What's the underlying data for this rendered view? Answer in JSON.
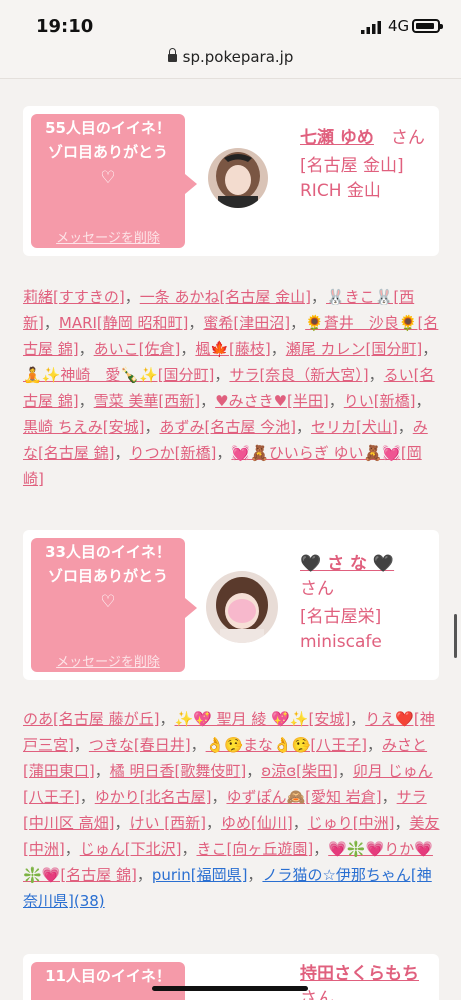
{
  "status": {
    "time": "19:10",
    "network": "4G"
  },
  "browser": {
    "url": "sp.pokepara.jp"
  },
  "cards": [
    {
      "message": "55人目のイイネ！ ゾロ目ありがとう",
      "heart": "♡",
      "delete_label": "メッセージを削除",
      "name": "七瀬 ゆめ",
      "honorific": "さん",
      "shop": "[名古屋 金山] RICH 金山"
    },
    {
      "message": "33人目のイイネ！ ゾロ目ありがとう",
      "heart": "♡",
      "delete_label": "メッセージを削除",
      "name": "🖤 さ な 🖤",
      "honorific": "さん",
      "shop": "[名古屋栄] miniscafe"
    },
    {
      "message": "11人目のイイネ！",
      "name": "持田さくらもち",
      "honorific": "さん"
    }
  ],
  "likers_1": [
    "莉緒[すすきの]",
    "一条 あかね[名古屋 金山]",
    "🐰きこ🐰[西新]",
    "MARI[静岡 昭和町]",
    "蜜希[津田沼]",
    "🌻蒼井　沙良🌻[名古屋 錦]",
    "あいこ[佐倉]",
    "楓🍁[藤枝]",
    "瀬尾 カレン[国分町]",
    "🧘✨神崎　愛🍾✨[国分町]",
    "サラ[奈良（新大宮）]",
    "るい[名古屋 錦]",
    "雪菜 美華[西新]",
    "♥みさき♥[半田]",
    "りい[新橋]",
    "黒崎 ちえみ[安城]",
    "あずみ[名古屋 今池]",
    "セリカ[犬山]",
    "みな[名古屋 錦]",
    "りつか[新橋]",
    "💓🧸ひいらぎ ゆい🧸💓[岡崎]"
  ],
  "likers_2": [
    "のあ[名古屋 藤が丘]",
    "✨💖 聖月 綾 💖✨[安城]",
    "りえ❤️[神戸三宮]",
    "つきな[春日井]",
    "👌🤥まな👌🤥[八王子]",
    "みさと[蒲田東口]",
    "橘 明日香[歌舞伎町]",
    "ʚ涼ɞ[柴田]",
    "卯月 じゅん[八王子]",
    "ゆかり[北名古屋]",
    "ゆずぽん🙈[愛知 岩倉]",
    "サラ[中川区 高畑]",
    "けい [西新]",
    "ゆめ[仙川]",
    "じゅり[中洲]",
    "美友[中洲]",
    "じゅん[下北沢]",
    "きこ[向ヶ丘遊園]",
    "💗❇️💗りか💗❇️💗[名古屋 錦]",
    "purin[福岡県]",
    "ノラ猫の☆伊那ちゃん[神奈川県](38)"
  ],
  "colors": {
    "accent": "#e0607e",
    "bubble": "#f59aa9",
    "link_blue": "#2a6fd1"
  }
}
